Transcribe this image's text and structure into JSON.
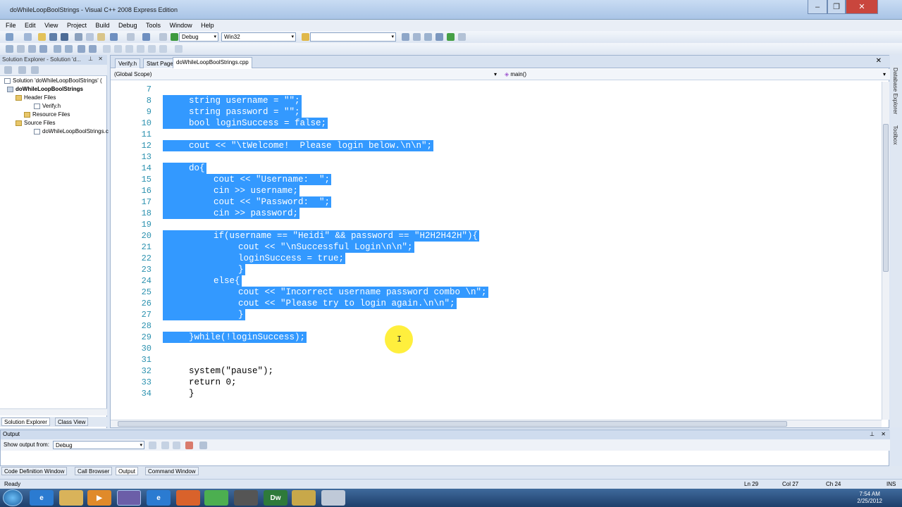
{
  "window": {
    "title": "doWhileLoopBoolStrings - Visual C++ 2008 Express Edition",
    "minimize": "‒",
    "maximize": "❐",
    "close": "✕"
  },
  "menu": [
    "File",
    "Edit",
    "View",
    "Project",
    "Build",
    "Debug",
    "Tools",
    "Window",
    "Help"
  ],
  "toolbar": {
    "config": "Debug",
    "platform": "Win32"
  },
  "solution_explorer": {
    "header": "Solution Explorer - Solution 'd...",
    "items": [
      "Solution 'doWhileLoopBoolStrings' (",
      "doWhileLoopBoolStrings",
      "Header Files",
      "Verify.h",
      "Resource Files",
      "Source Files",
      "doWhileLoopBoolStrings.c"
    ],
    "tabs": [
      "Solution Explorer",
      "Class View"
    ]
  },
  "editor": {
    "tabs": [
      "Verify.h",
      "Start Page",
      "doWhileLoopBoolStrings.cpp"
    ],
    "scope": "(Global Scope)",
    "member": "main()",
    "lines": [
      {
        "n": "7",
        "text": "",
        "sel": false
      },
      {
        "n": "8",
        "text": "string username = \"\";",
        "sel": true,
        "indent": 1
      },
      {
        "n": "9",
        "text": "string password = \"\";",
        "sel": true,
        "indent": 1
      },
      {
        "n": "10",
        "text": "bool loginSuccess = false;",
        "sel": true,
        "indent": 1
      },
      {
        "n": "11",
        "text": "",
        "sel": true,
        "indent": 0
      },
      {
        "n": "12",
        "text": "cout << \"\\tWelcome!  Please login below.\\n\\n\";",
        "sel": true,
        "indent": 1
      },
      {
        "n": "13",
        "text": "",
        "sel": true,
        "indent": 0
      },
      {
        "n": "14",
        "text": "do{",
        "sel": true,
        "indent": 1
      },
      {
        "n": "15",
        "text": "cout << \"Username:  \";",
        "sel": true,
        "indent": 2
      },
      {
        "n": "16",
        "text": "cin >> username;",
        "sel": true,
        "indent": 2
      },
      {
        "n": "17",
        "text": "cout << \"Password:  \";",
        "sel": true,
        "indent": 2
      },
      {
        "n": "18",
        "text": "cin >> password;",
        "sel": true,
        "indent": 2
      },
      {
        "n": "19",
        "text": "",
        "sel": true,
        "indent": 0
      },
      {
        "n": "20",
        "text": "if(username == \"Heidi\" && password == \"H2H2H42H\"){",
        "sel": true,
        "indent": 2
      },
      {
        "n": "21",
        "text": "cout << \"\\nSuccessful Login\\n\\n\";",
        "sel": true,
        "indent": 3
      },
      {
        "n": "22",
        "text": "loginSuccess = true;",
        "sel": true,
        "indent": 3
      },
      {
        "n": "23",
        "text": "}",
        "sel": true,
        "indent": 3
      },
      {
        "n": "24",
        "text": "else{",
        "sel": true,
        "indent": 2
      },
      {
        "n": "25",
        "text": "cout << \"Incorrect username password combo \\n\";",
        "sel": true,
        "indent": 3
      },
      {
        "n": "26",
        "text": "cout << \"Please try to login again.\\n\\n\";",
        "sel": true,
        "indent": 3
      },
      {
        "n": "27",
        "text": "}",
        "sel": true,
        "indent": 3
      },
      {
        "n": "28",
        "text": "",
        "sel": true,
        "indent": 0
      },
      {
        "n": "29",
        "text": "}while(!loginSuccess);",
        "sel": true,
        "indent": 1
      },
      {
        "n": "30",
        "text": "",
        "sel": false
      },
      {
        "n": "31",
        "text": "",
        "sel": false
      },
      {
        "n": "32",
        "text": "system(\"pause\");",
        "sel": false,
        "indent": 1
      },
      {
        "n": "33",
        "text": "return 0;",
        "sel": false,
        "indent": 1
      },
      {
        "n": "34",
        "text": "}",
        "sel": false,
        "indent": 1
      }
    ]
  },
  "right_strip": [
    "Database Explorer",
    "Toolbox"
  ],
  "output": {
    "title": "Output",
    "show_from_label": "Show output from:",
    "show_from_value": "Debug"
  },
  "bottom_tabs": [
    "Code Definition Window",
    "Call Browser",
    "Output",
    "Command Window"
  ],
  "status": {
    "ready": "Ready",
    "ln": "Ln 29",
    "col": "Col 27",
    "ch": "Ch 24",
    "ins": "INS"
  },
  "taskbar": {
    "time": "7:54 AM",
    "date": "2/25/2012",
    "apps": [
      "ie-icon",
      "explorer-icon",
      "media-player-icon",
      "visual-studio-icon",
      "ie-icon",
      "firefox-icon",
      "chrome-icon",
      "chess-icon",
      "dreamweaver-icon",
      "app-icon",
      "notepad-icon"
    ],
    "dw_label": "Dw"
  }
}
